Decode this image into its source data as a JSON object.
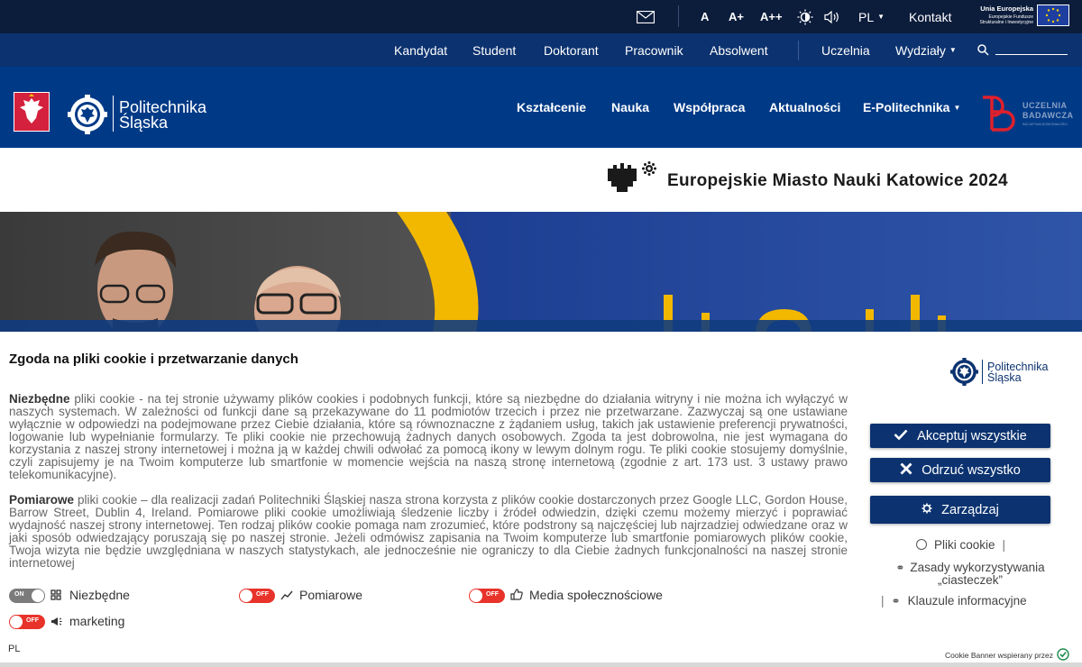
{
  "topbar": {
    "font_small": "A",
    "font_medium": "A+",
    "font_large": "A++",
    "language": "PL",
    "contact": "Kontakt",
    "eu_title": "Unia Europejska",
    "eu_sub1": "Europejskie Fundusze",
    "eu_sub2": "Strukturalne i Inwestycyjne",
    "icons": [
      "mail-icon",
      "contrast-icon",
      "sound-icon"
    ]
  },
  "secnav": {
    "items": [
      "Kandydat",
      "Student",
      "Doktorant",
      "Pracownik",
      "Absolwent"
    ],
    "uczelnia": "Uczelnia",
    "wydzialy": "Wydziały"
  },
  "mainhead": {
    "logo_line1": "Politechnika",
    "logo_line2": "Śląska",
    "nav": [
      "Kształcenie",
      "Nauka",
      "Współpraca",
      "Aktualności"
    ],
    "e_politechnika": "E-Politechnika",
    "badge_line1": "UCZELNIA",
    "badge_line2": "BADAWCZA",
    "badge_line3": "INICJATYWA DOSKONAŁOŚCI"
  },
  "emn": {
    "text": "Europejskie Miasto Nauki  Katowice 2024"
  },
  "cookie": {
    "title": "Zgoda na pliki cookie i przetwarzanie danych",
    "para1_bold": "Niezbędne",
    "para1": " pliki cookie - na tej stronie używamy plików cookies i podobnych funkcji, które są niezbędne do działania witryny i nie można ich wyłączyć w naszych systemach. W zależności od funkcji dane są przekazywane do 11 podmiotów trzecich i przez nie przetwarzane. Zazwyczaj są one ustawiane wyłącznie w odpowiedzi na podejmowane przez Ciebie działania, które są równoznaczne z żądaniem usług, takich jak ustawienie preferencji prywatności, logowanie lub wypełnianie formularzy. Te pliki cookie nie przechowują żadnych danych osobowych. Zgoda ta jest dobrowolna, nie jest wymagana do korzystania z naszej strony internetowej i można ją w każdej chwili odwołać za pomocą ikony w lewym dolnym rogu. Te pliki cookie stosujemy domyślnie, czyli zapisujemy je na Twoim komputerze lub smartfonie w momencie wejścia na naszą stronę internetową (zgodnie z art. 173 ust. 3 ustawy prawo telekomunikacyjne).",
    "para2_bold": "Pomiarowe",
    "para2": " pliki cookie – dla realizacji zadań Politechniki Śląskiej nasza strona korzysta z plików cookie dostarczonych przez Google LLC, Gordon House, Barrow Street, Dublin 4, Ireland. Pomiarowe pliki cookie umożliwiają śledzenie liczby i źródeł odwiedzin, dzięki czemu możemy mierzyć i poprawiać wydajność naszej strony internetowej. Ten rodzaj plików cookie pomaga nam zrozumieć, które podstrony są najczęściej lub najrzadziej odwiedzane oraz w jaki sposób odwiedzający poruszają się po naszej stronie. Jeżeli odmówisz zapisania na Twoim komputerze lub smartfonie pomiarowych plików cookie, Twoja wizyta nie będzie uwzględniana w naszych statystykach, ale jednocześnie nie ograniczy to dla Ciebie żadnych funkcjonalności na naszej stronie internetowej",
    "categories": [
      {
        "label": "Niezbędne",
        "state": "ON",
        "on": true,
        "icon": "grid-icon"
      },
      {
        "label": "Pomiarowe",
        "state": "OFF",
        "on": false,
        "icon": "chart-icon"
      },
      {
        "label": "Media społecznościowe",
        "state": "OFF",
        "on": false,
        "icon": "thumbs-up-icon"
      },
      {
        "label": "marketing",
        "state": "OFF",
        "on": false,
        "icon": "megaphone-icon"
      }
    ],
    "logo_line1": "Politechnika",
    "logo_line2": "Śląska",
    "accept_all": "Akceptuj wszystkie",
    "reject_all": "Odrzuć wszystko",
    "manage": "Zarządzaj",
    "link_cookies": "Pliki cookie",
    "link_rules_1": "Zasady wykorzystywania",
    "link_rules_2": "„ciasteczek”",
    "link_clauses": "Klauzule informacyjne",
    "lang": "PL",
    "powered": "Cookie Banner wspierany przez"
  },
  "colors": {
    "topbar": "#0c1c3b",
    "secnav": "#0c326f",
    "mainhead": "#003a87",
    "button": "#0c3370",
    "toggle_off": "#e8332a",
    "toggle_on": "#7b7b7b",
    "badge_red": "#e0202c",
    "hero_yellow": "#f2b800"
  }
}
